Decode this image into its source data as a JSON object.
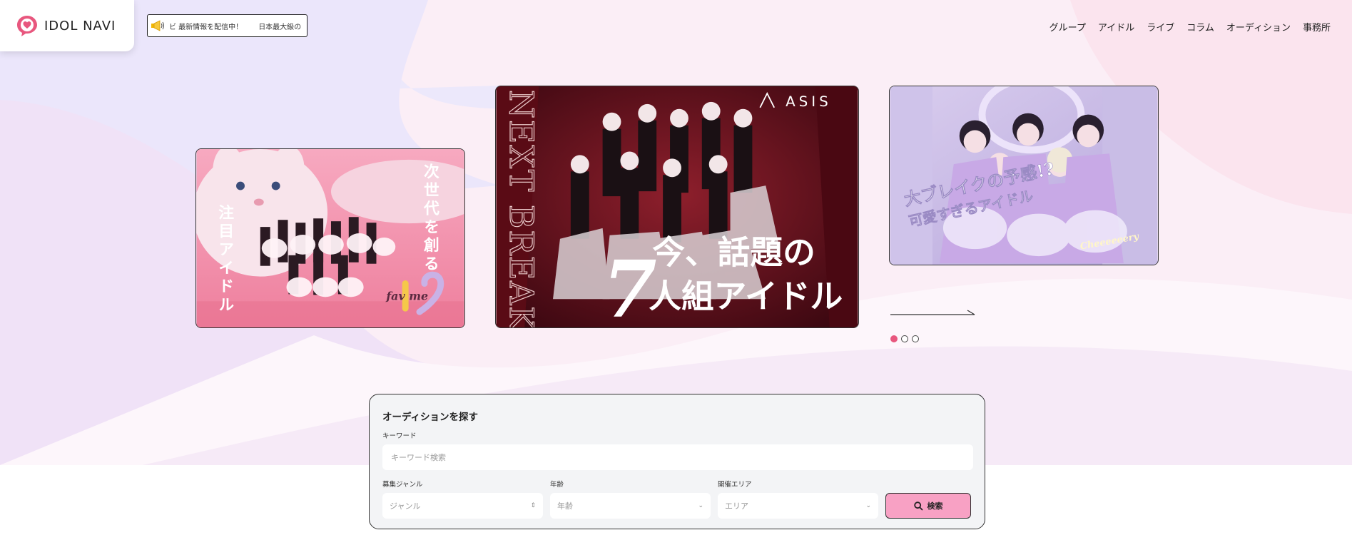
{
  "header": {
    "logo_text": "IDOL NAVI",
    "ticker": [
      "ビ 最新情報を配信中！",
      "日本最大級の"
    ],
    "nav": [
      "グループ",
      "アイドル",
      "ライブ",
      "コラム",
      "オーディション",
      "事務所"
    ]
  },
  "slides": {
    "left": {
      "text_right": "次世代を創る",
      "text_left": "注目アイドル",
      "brand": "fav me"
    },
    "center": {
      "side_text": "NEXT BREAK",
      "brand": "ASIS",
      "big_number": "7",
      "line1": "今、話題の",
      "line2": "人組アイドル"
    },
    "right": {
      "line1": "大ブレイクの予感!?",
      "line2": "可愛すぎるアイドル",
      "brand": "Cheeeeeery"
    }
  },
  "slider": {
    "active_index": 0,
    "count": 3
  },
  "search": {
    "title": "オーディションを探す",
    "keyword_label": "キーワード",
    "keyword_placeholder": "キーワード検索",
    "genre_label": "募集ジャンル",
    "genre_placeholder": "ジャンル",
    "age_label": "年齢",
    "age_placeholder": "年齢",
    "area_label": "開催エリア",
    "area_placeholder": "エリア",
    "button_label": "検索"
  },
  "colors": {
    "accent": "#e8577e",
    "button": "#f8a1c4",
    "panel": "#f3f4f6"
  }
}
